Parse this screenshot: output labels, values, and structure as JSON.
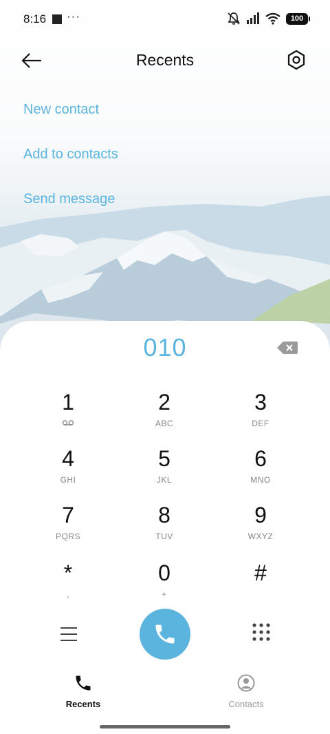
{
  "status_bar": {
    "time": "8:16",
    "notification_dots": "···",
    "battery": "100",
    "icons": [
      "notification-icon",
      "mute-icon",
      "signal-icon",
      "wifi-icon",
      "battery-icon"
    ]
  },
  "header": {
    "title": "Recents",
    "back_icon": "arrow-left-icon",
    "settings_icon": "hexagon-settings-icon"
  },
  "actions": [
    {
      "label": "New contact"
    },
    {
      "label": "Add to contacts"
    },
    {
      "label": "Send message"
    }
  ],
  "dialer": {
    "number": "010",
    "backspace_icon": "backspace-icon",
    "keys": [
      {
        "digit": "1",
        "letters": "",
        "icon": "voicemail-icon"
      },
      {
        "digit": "2",
        "letters": "ABC"
      },
      {
        "digit": "3",
        "letters": "DEF"
      },
      {
        "digit": "4",
        "letters": "GHI"
      },
      {
        "digit": "5",
        "letters": "JKL"
      },
      {
        "digit": "6",
        "letters": "MNO"
      },
      {
        "digit": "7",
        "letters": "PQRS"
      },
      {
        "digit": "8",
        "letters": "TUV"
      },
      {
        "digit": "9",
        "letters": "WXYZ"
      },
      {
        "digit": "*",
        "letters": ","
      },
      {
        "digit": "0",
        "letters": "+"
      },
      {
        "digit": "#",
        "letters": ""
      }
    ]
  },
  "controls": {
    "menu_icon": "menu-icon",
    "call_icon": "phone-icon",
    "dialpad_icon": "dialpad-icon"
  },
  "bottom_nav": {
    "items": [
      {
        "label": "Recents",
        "icon": "phone-icon",
        "active": true
      },
      {
        "label": "Contacts",
        "icon": "contact-icon",
        "active": false
      }
    ]
  },
  "colors": {
    "accent": "#5bb4de",
    "text": "#111111",
    "muted": "#888888"
  }
}
